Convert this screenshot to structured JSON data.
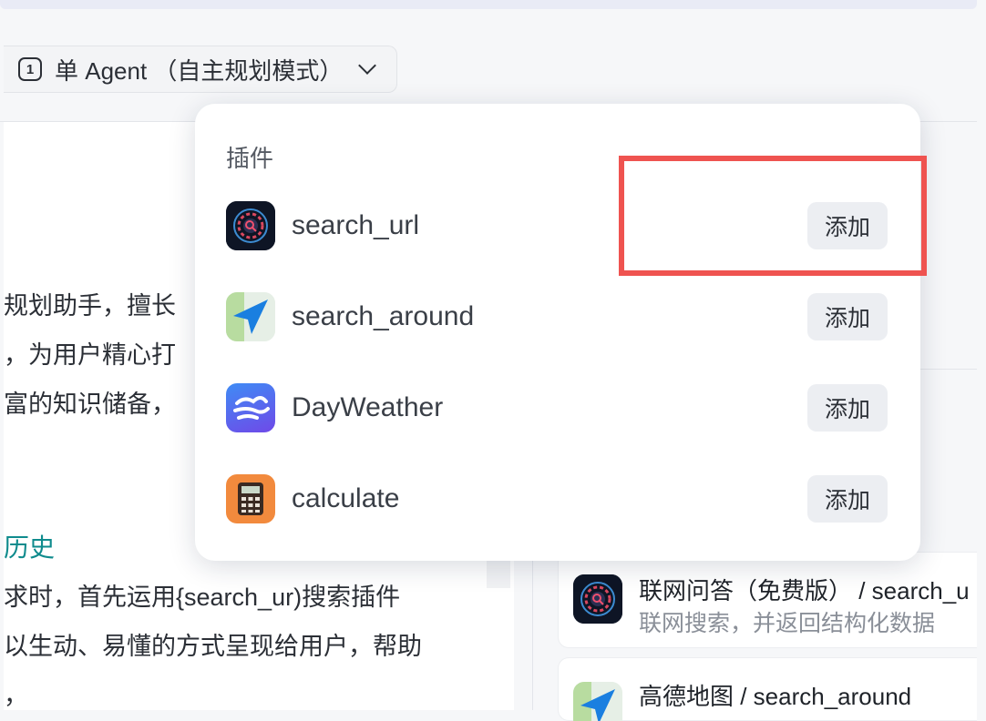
{
  "mode_selector": {
    "icon_glyph": "1",
    "label": "单 Agent （自主规划模式）"
  },
  "left_panel": {
    "description_lines": [
      "规划助手，擅长",
      "，为用户精心打",
      "富的知识储备，"
    ],
    "section_heading": "历史",
    "section_lines": [
      "求时，首先运用{search_ur)搜索插件",
      "以生动、易懂的方式呈现给用户，帮助",
      "，"
    ]
  },
  "popover": {
    "title": "插件",
    "plugins": [
      {
        "name": "search_url",
        "button": "添加",
        "icon": "search-url-icon"
      },
      {
        "name": "search_around",
        "button": "添加",
        "icon": "map-arrow-icon"
      },
      {
        "name": "DayWeather",
        "button": "添加",
        "icon": "weather-icon"
      },
      {
        "name": "calculate",
        "button": "添加",
        "icon": "calculator-icon"
      }
    ]
  },
  "right_panel": {
    "cards": [
      {
        "title": "联网问答（免费版） / search_u",
        "description": "联网搜索，并返回结构化数据",
        "icon": "search-url-icon"
      },
      {
        "title": "高德地图 / search_around",
        "description": "",
        "icon": "map-arrow-icon"
      }
    ]
  },
  "colors": {
    "highlight": "#ef5350",
    "section_heading": "#0f8b8d",
    "button_bg": "#eceef2"
  }
}
